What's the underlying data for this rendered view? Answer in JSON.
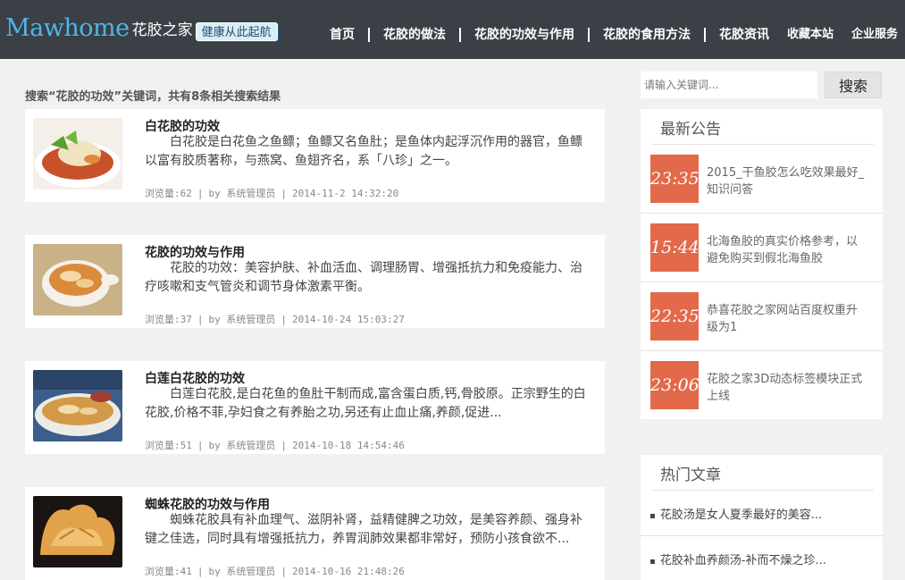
{
  "header": {
    "logo_en": "Mawhome",
    "logo_cn": "花胶之家",
    "slogan": "健康从此起航",
    "nav": [
      "首页",
      "花胶的做法",
      "花胶的功效与作用",
      "花胶的食用方法",
      "花胶资讯"
    ],
    "bookmark": "收藏本站",
    "enterprise": "企业服务"
  },
  "search_summary": "搜索“花胶的功效”关键词，共有8条相关搜索结果",
  "articles": [
    {
      "title": "白花胶的功效",
      "excerpt": "白花胶是白花鱼之鱼鳔；鱼鳔又名鱼肚；是鱼体内起浮沉作用的器官，鱼鳔以富有胶质著称，与燕窝、鱼翅齐名，系「八珍」之一。",
      "views": "浏览量:62",
      "author": "by 系统管理员",
      "date": "2014-11-2 14:32:20"
    },
    {
      "title": "花胶的功效与作用",
      "excerpt": "花胶的功效：美容护肤、补血活血、调理肠胃、增强抵抗力和免疫能力、治疗咳嗽和支气管炎和调节身体激素平衡。",
      "views": "浏览量:37",
      "author": "by 系统管理员",
      "date": "2014-10-24 15:03:27"
    },
    {
      "title": "白莲白花胶的功效",
      "excerpt": "白莲白花胶,是白花鱼的鱼肚干制而成,富含蛋白质,钙,骨胶原。正宗野生的白花胶,价格不菲,孕妇食之有养胎之功,另还有止血止痛,养颜,促进...",
      "views": "浏览量:51",
      "author": "by 系统管理员",
      "date": "2014-10-18 14:54:46"
    },
    {
      "title": "蜘蛛花胶的功效与作用",
      "excerpt": "蜘蛛花胶具有补血理气、滋阴补肾，益精健脾之功效，是美容养颜、强身补键之佳选，同时具有增强抵抗力，养胃润肺效果都非常好，预防小孩食欲不...",
      "views": "浏览量:41",
      "author": "by 系统管理员",
      "date": "2014-10-16 21:48:26"
    }
  ],
  "sidebar": {
    "search": {
      "placeholder": "请输入关键词...",
      "button": "搜索"
    },
    "notices": {
      "title": "最新公告",
      "items": [
        {
          "time": "23:35",
          "text": "2015_干鱼胶怎么吃效果最好_知识问答"
        },
        {
          "time": "15:44",
          "text": "北海鱼胶的真实价格参考，以避免购买到假北海鱼胶"
        },
        {
          "time": "22:35",
          "text": "恭喜花胶之家网站百度权重升级为1"
        },
        {
          "time": "23:06",
          "text": "花胶之家3D动态标签模块正式上线"
        }
      ]
    },
    "hot": {
      "title": "热门文章",
      "items": [
        "花胶汤是女人夏季最好的美容...",
        "花胶补血养颜汤-补而不燥之珍..."
      ]
    }
  },
  "colors": {
    "header_bg": "#3b3f46",
    "logo_blue": "#4fb6e6",
    "time_box": "#e2694a"
  }
}
